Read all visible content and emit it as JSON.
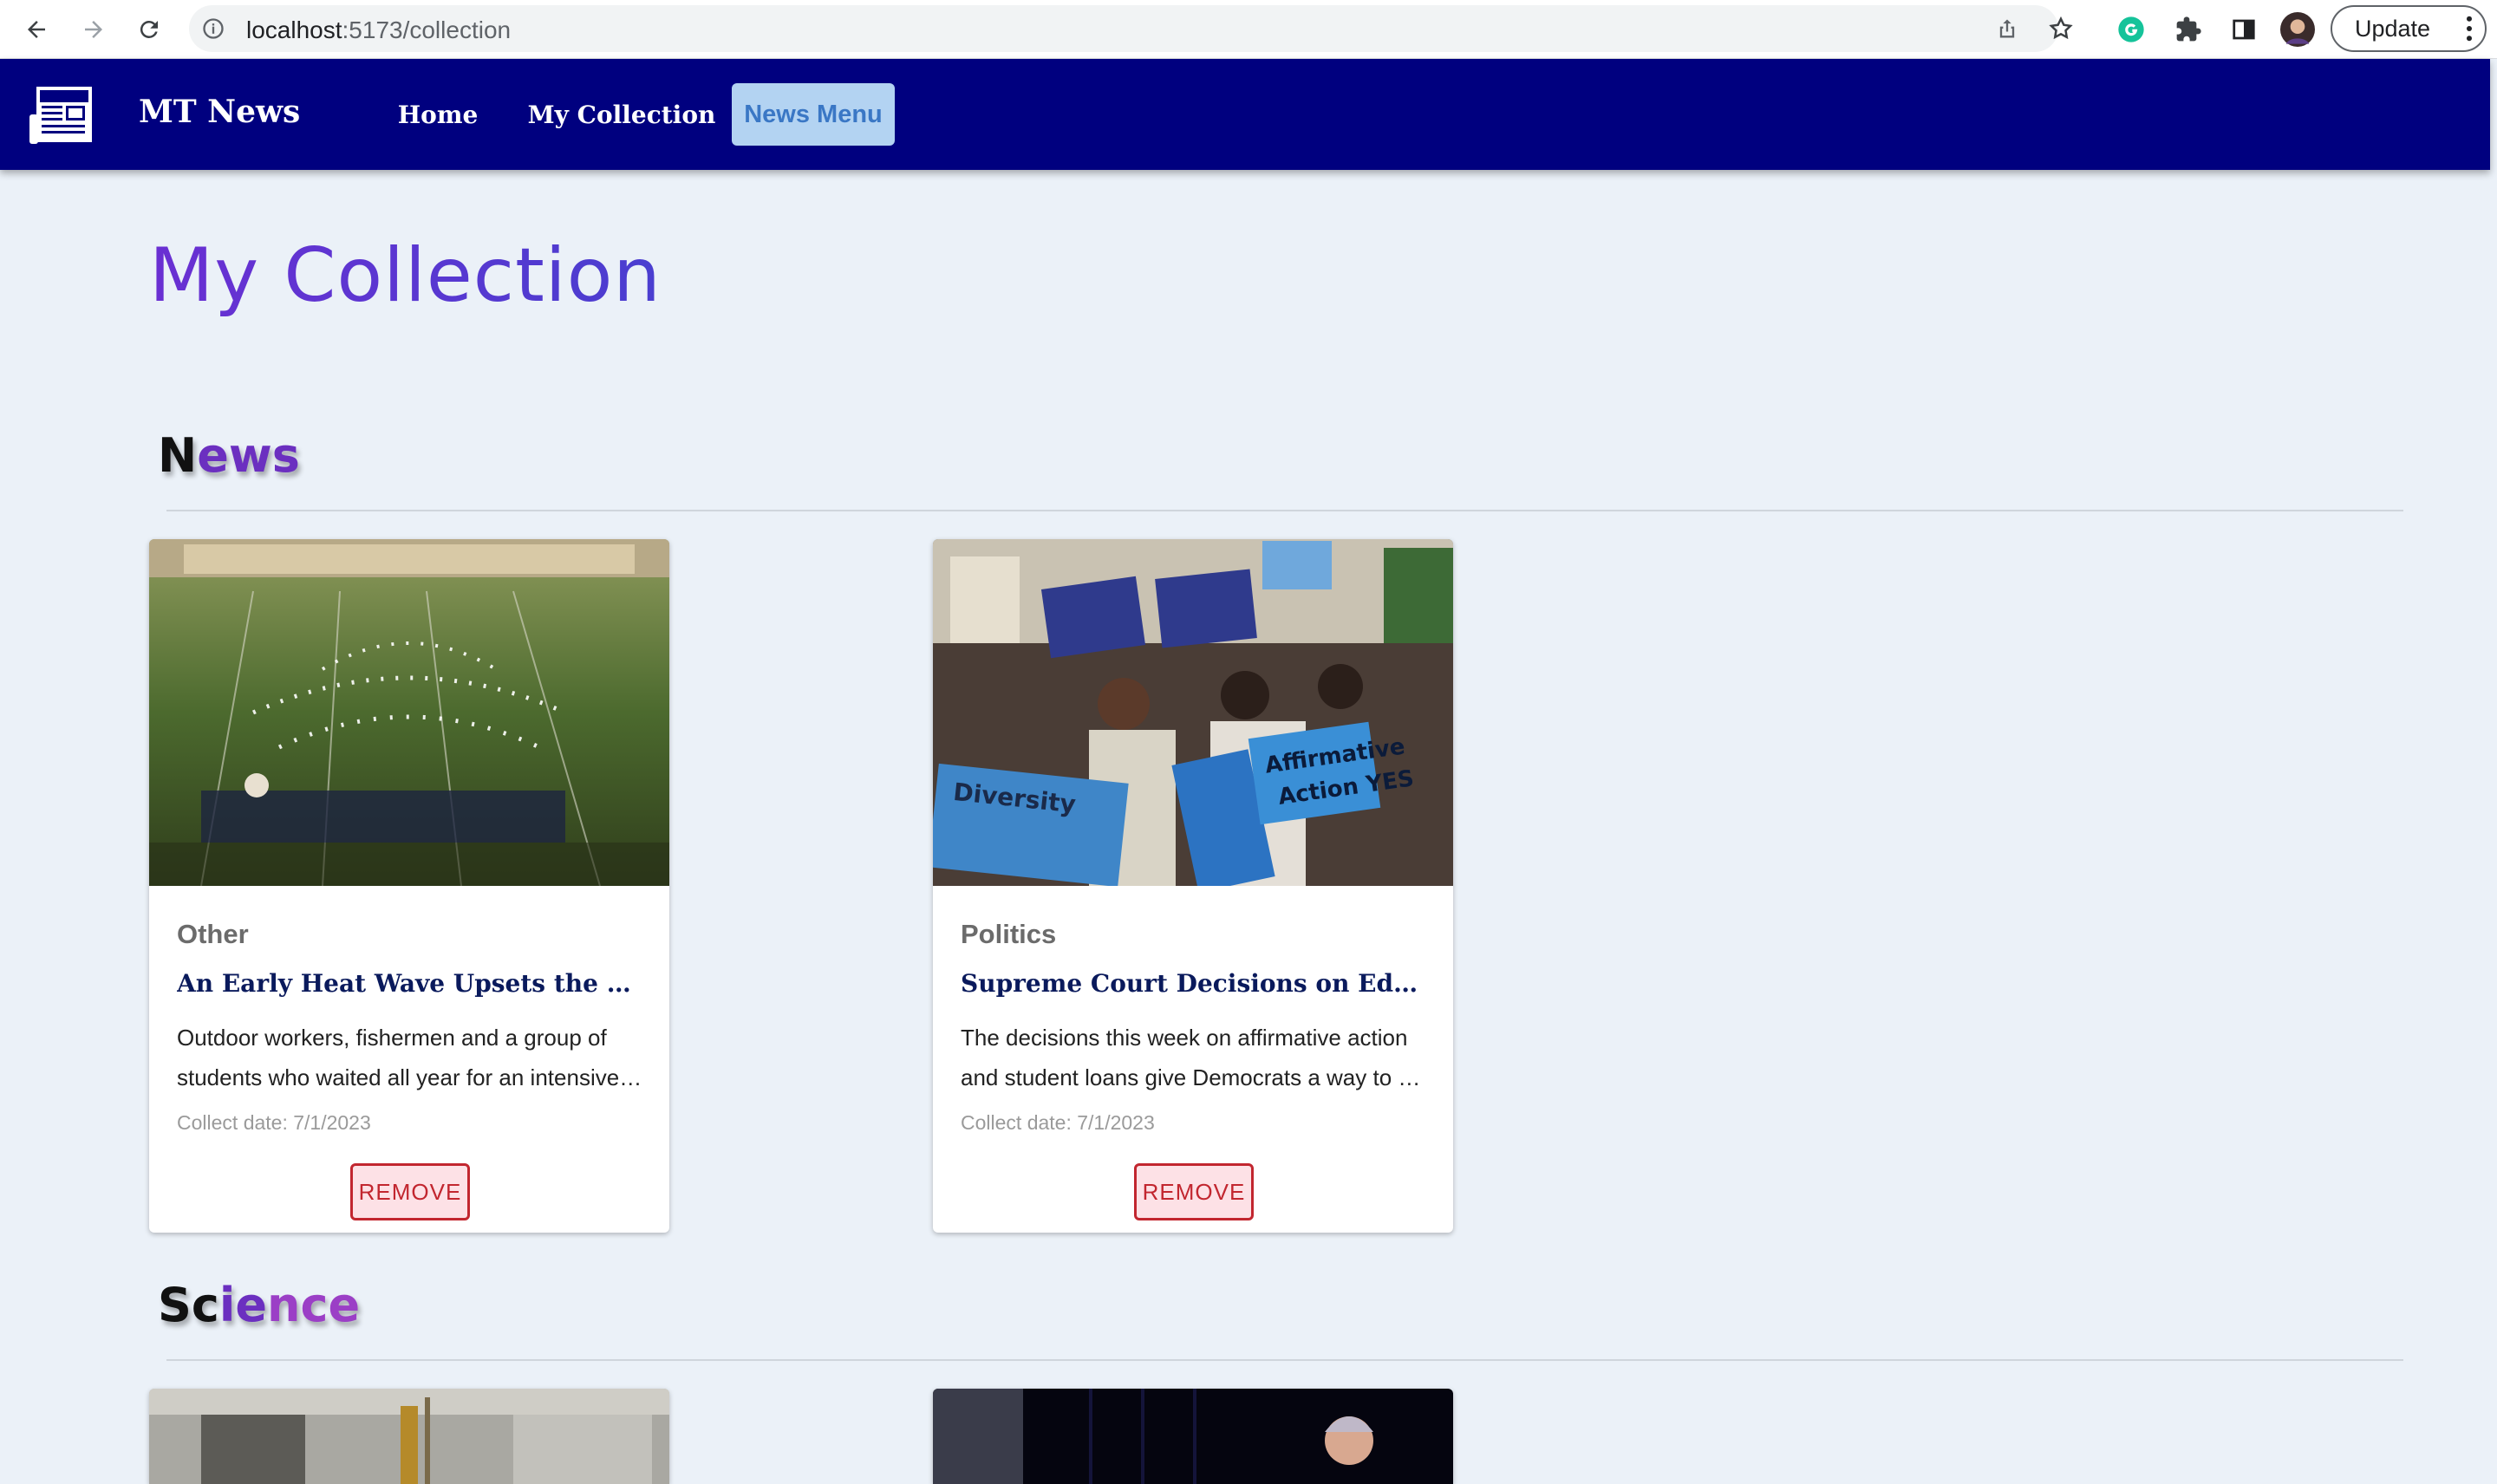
{
  "browser": {
    "url_host": "localhost",
    "url_path": ":5173/collection",
    "update_label": "Update"
  },
  "header": {
    "brand": "MT News",
    "nav": [
      {
        "label": "Home"
      },
      {
        "label": "My Collection"
      },
      {
        "label": "News Menu"
      }
    ]
  },
  "page": {
    "title": "My Collection",
    "sections": [
      {
        "title_parts": [
          "N",
          "ews",
          ""
        ],
        "cards": [
          {
            "category": "Other",
            "title": "An Early Heat Wave Upsets the Rhythm of Summer Life",
            "desc_line1": "Outdoor workers, fishermen and a group of",
            "desc_line2": "students who waited all year for an intensive band camp",
            "date": "Collect date: 7/1/2023",
            "button": "REMOVE"
          },
          {
            "category": "Politics",
            "title": "Supreme Court Decisions on Education and Student Loans",
            "desc_line1": "The decisions this week on affirmative action",
            "desc_line2": "and student loans give Democrats a way to energize voters",
            "date": "Collect date: 7/1/2023",
            "button": "REMOVE"
          }
        ]
      },
      {
        "title_parts": [
          "Sc",
          "ie",
          "nce"
        ]
      }
    ]
  },
  "colors": {
    "appbar": "#00007f",
    "page_bg": "#ebf1f8",
    "title_gradient_start": "#6a2fd2",
    "remove_border": "#c2262f"
  }
}
